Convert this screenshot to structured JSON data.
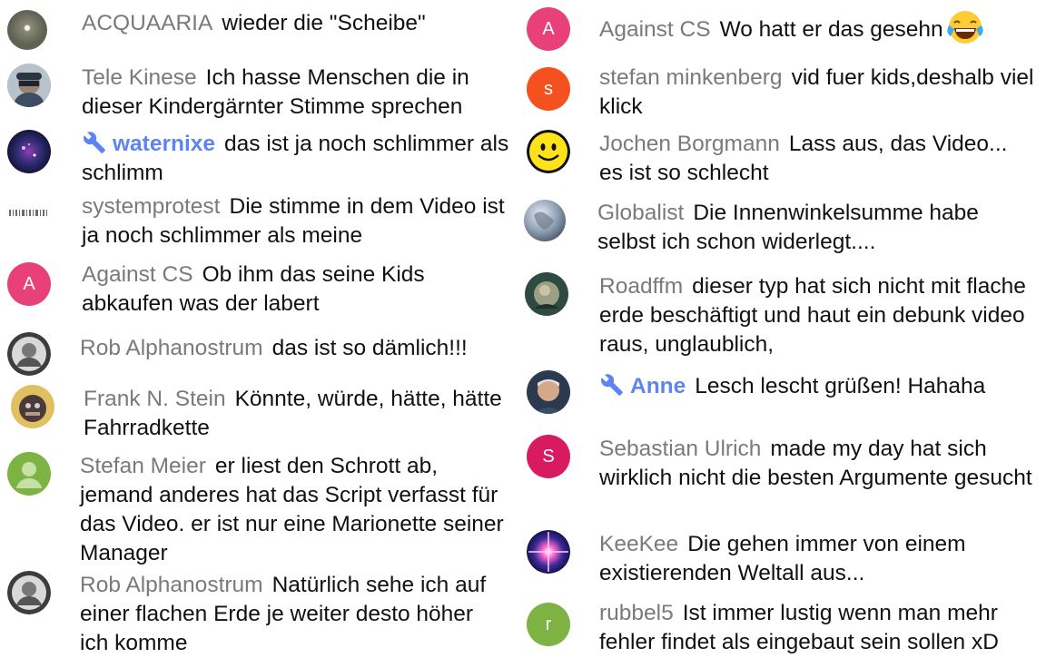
{
  "left": [
    {
      "author": "ACQUAARIA",
      "message": "wieder die \"Scheibe\""
    },
    {
      "author": "Tele Kinese",
      "message": "Ich hasse Menschen die in dieser Kindergärnter Stimme sprechen"
    },
    {
      "author": "waternixe",
      "message": "das ist ja noch schlimmer als schlimm",
      "moderator": true
    },
    {
      "author": "systemprotest",
      "message": "Die stimme in dem Video ist ja noch schlimmer als meine"
    },
    {
      "author": "Against CS",
      "message": "Ob ihm das seine Kids abkaufen was der labert",
      "initial": "A"
    },
    {
      "author": "Rob Alphanostrum",
      "message": "das ist so dämlich!!!"
    },
    {
      "author": "Frank N. Stein",
      "message": "Könnte, würde, hätte, hätte Fahrradkette"
    },
    {
      "author": "Stefan Meier",
      "message": "er liest den Schrott ab, jemand anderes hat das Script verfasst für das Video. er ist nur eine Marionette seiner Manager"
    },
    {
      "author": "Rob Alphanostrum",
      "message": "Natürlich sehe ich auf einer flachen Erde je weiter desto höher ich komme"
    }
  ],
  "right": [
    {
      "author": "Against CS",
      "message": "Wo hatt er das gesehn",
      "initial": "A",
      "emoji": "tears-of-joy-emoji"
    },
    {
      "author": "stefan minkenberg",
      "message": "vid fuer kids,deshalb viel klick",
      "initial": "s"
    },
    {
      "author": "Jochen Borgmann",
      "message": "Lass aus, das Video... es ist so schlecht"
    },
    {
      "author": "Globalist",
      "message": "Die Innenwinkelsumme habe selbst ich schon widerlegt...."
    },
    {
      "author": "Roadffm",
      "message": "dieser typ hat sich nicht mit flache erde beschäftigt und haut ein debunk video raus, unglaublich,"
    },
    {
      "author": "Anne",
      "message": "Lesch lescht grüßen! Hahaha",
      "moderator": true
    },
    {
      "author": "Sebastian Ulrich",
      "message": "made my day hat sich wirklich nicht die besten Argumente gesucht",
      "initial": "S"
    },
    {
      "author": "KeeKee",
      "message": "Die gehen immer von einem existierenden Weltall aus..."
    },
    {
      "author": "rubbel5",
      "message": "Ist immer lustig wenn man mehr fehler findet als eingebaut sein sollen xD",
      "initial": "r"
    }
  ],
  "colors": {
    "author": "#7a7a7a",
    "moderator": "#5e84f1",
    "text": "#111111",
    "pink": "#e8417a",
    "orange": "#f4511e",
    "crimson": "#d81b60",
    "green": "#7cb342"
  }
}
